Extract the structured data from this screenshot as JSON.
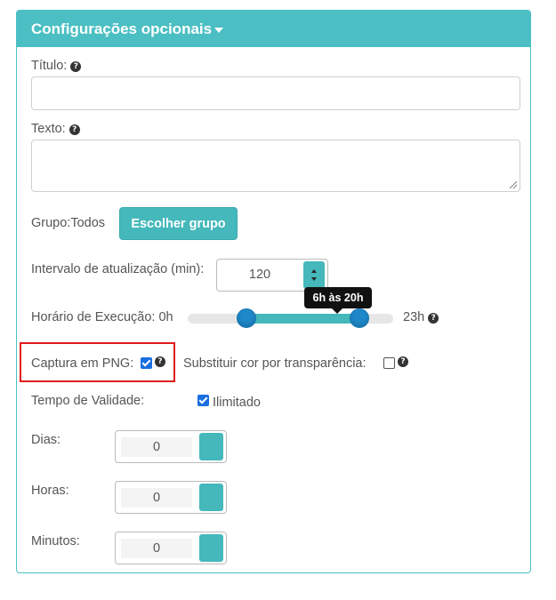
{
  "panel": {
    "title": "Configurações opcionais",
    "accent_color": "#4bbfc3"
  },
  "fields": {
    "titulo": {
      "label": "Título:",
      "value": ""
    },
    "texto": {
      "label": "Texto:",
      "value": ""
    },
    "grupo": {
      "label": "Grupo:Todos",
      "button": "Escolher grupo"
    },
    "intervalo": {
      "label": "Intervalo de atualização (min):",
      "value": "120"
    },
    "horario": {
      "label": "Horário de Execução: 0h",
      "max_label": "23h",
      "tooltip": "6h às 20h",
      "min": 0,
      "max": 23,
      "start": 6,
      "end": 20
    },
    "captura_png": {
      "label": "Captura em PNG:",
      "checked": true
    },
    "substituir": {
      "label": "Substituir cor por transparência:",
      "checked": false
    },
    "validade": {
      "label": "Tempo de Validade:",
      "ilimitado_label": "Ilimitado",
      "ilimitado_checked": true
    },
    "dias": {
      "label": "Dias:",
      "value": "0"
    },
    "horas": {
      "label": "Horas:",
      "value": "0"
    },
    "minutos": {
      "label": "Minutos:",
      "value": "0"
    }
  },
  "icons": {
    "help": "question-circle-icon",
    "caret": "caret-down-icon"
  },
  "help_glyph": "?"
}
